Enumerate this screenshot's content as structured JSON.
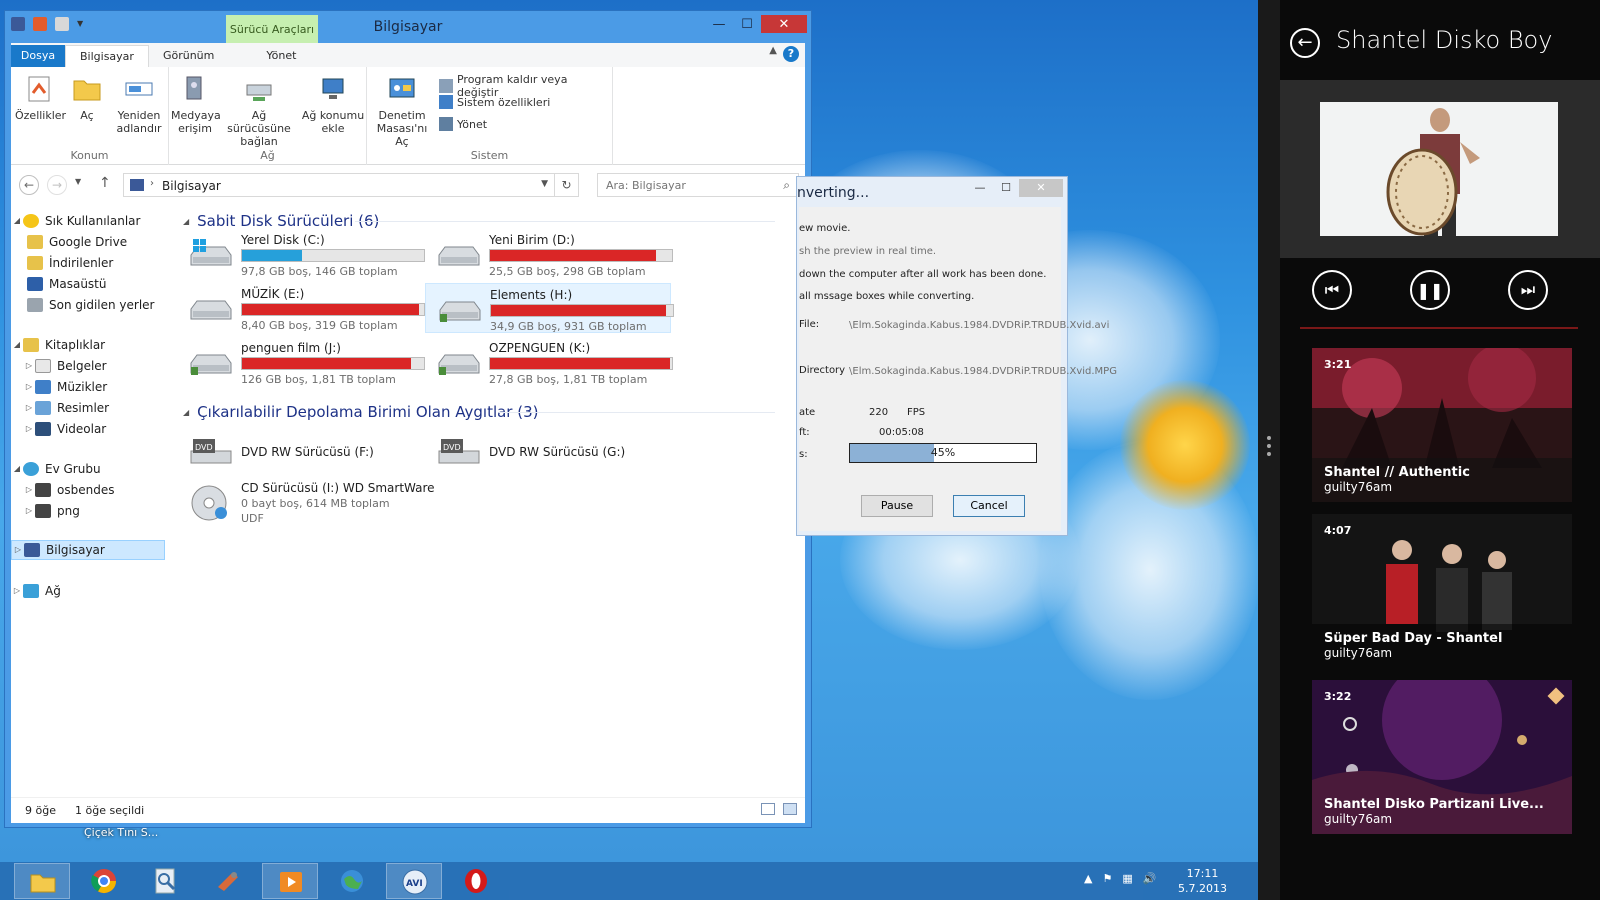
{
  "explorer": {
    "title": "Bilgisayar",
    "context_tab": "Sürücü Araçları",
    "tabs": [
      "Dosya",
      "Bilgisayar",
      "Görünüm",
      "Yönet"
    ],
    "ribbon": {
      "konum": {
        "label": "Konum",
        "buttons": [
          {
            "label": "Özellikler",
            "icon": "properties-icon"
          },
          {
            "label": "Aç",
            "icon": "folder-open-icon"
          },
          {
            "label": "Yeniden adlandır",
            "icon": "rename-icon"
          }
        ]
      },
      "ag": {
        "label": "Ağ",
        "buttons": [
          {
            "label": "Medyaya erişim",
            "icon": "media-access-icon"
          },
          {
            "label": "Ağ sürücüsüne bağlan",
            "icon": "map-drive-icon"
          },
          {
            "label": "Ağ konumu ekle",
            "icon": "add-network-location-icon"
          }
        ]
      },
      "sistem": {
        "label": "Sistem",
        "control_panel": "Denetim Masası'nı Aç",
        "items": [
          "Program kaldır veya değiştir",
          "Sistem özellikleri",
          "Yönet"
        ]
      }
    },
    "address": {
      "path": "Bilgisayar",
      "search_placeholder": "Ara: Bilgisayar"
    },
    "nav": {
      "favorites": {
        "label": "Sık Kullanılanlar",
        "items": [
          "Google Drive",
          "İndirilenler",
          "Masaüstü",
          "Son gidilen yerler"
        ]
      },
      "libraries": {
        "label": "Kitaplıklar",
        "items": [
          "Belgeler",
          "Müzikler",
          "Resimler",
          "Videolar"
        ]
      },
      "homegroup": {
        "label": "Ev Grubu",
        "items": [
          "osbendes",
          "png"
        ]
      },
      "computer": "Bilgisayar",
      "network": "Ağ"
    },
    "groups": {
      "hdd": "Sabit Disk Sürücüleri (6)",
      "removable": "Çıkarılabilir Depolama Birimi Olan Aygıtlar (3)"
    },
    "drives": [
      {
        "name": "Yerel Disk (C:)",
        "free": "97,8 GB boş, 146 GB toplam",
        "used_fraction": 0.33
      },
      {
        "name": "Yeni Birim (D:)",
        "free": "25,5 GB boş, 298 GB toplam",
        "used_fraction": 0.91
      },
      {
        "name": "MÜZİK (E:)",
        "free": "8,40 GB boş, 319 GB toplam",
        "used_fraction": 0.97
      },
      {
        "name": "Elements (H:)",
        "free": "34,9 GB boş, 931 GB toplam",
        "used_fraction": 0.96
      },
      {
        "name": "penguen film (J:)",
        "free": "126 GB boş, 1,81 TB toplam",
        "used_fraction": 0.93
      },
      {
        "name": "OZPENGUEN (K:)",
        "free": "27,8 GB boş, 1,81 TB toplam",
        "used_fraction": 0.99
      }
    ],
    "removable": [
      {
        "name": "DVD RW Sürücüsü (F:)"
      },
      {
        "name": "DVD RW Sürücüsü (G:)"
      },
      {
        "name": "CD Sürücüsü (I:) WD SmartWare",
        "free": "0 bayt boş, 614 MB toplam",
        "fs": "UDF"
      }
    ],
    "status": {
      "count": "9 öğe",
      "selected": "1 öğe seçildi"
    }
  },
  "desktop": {
    "label": "Çiçek Tını S..."
  },
  "dialog": {
    "title": "nverting...",
    "lines": [
      "ew movie.",
      "sh the preview in real time.",
      "down the computer after all work has been done.",
      "all mssage boxes while converting."
    ],
    "file_label": "File:",
    "file_path": "\\Elm.Sokaginda.Kabus.1984.DVDRiP.TRDUB.Xvid.avi",
    "dir_label": "Directory",
    "dir_path": "\\Elm.Sokaginda.Kabus.1984.DVDRiP.TRDUB.Xvid.MPG",
    "rate_label": "ate",
    "rate_value": "220",
    "rate_unit": "FPS",
    "left_label": "ft:",
    "left_value": "00:05:08",
    "progress_label": "s:",
    "progress_text": "45%",
    "progress": 0.45,
    "pause": "Pause",
    "cancel": "Cancel"
  },
  "taskbar": {
    "apps": [
      "file-explorer-icon",
      "chrome-icon",
      "search-icon",
      "tool-icon",
      "media-player-icon",
      "globe-icon",
      "avi-converter-icon",
      "opera-icon"
    ],
    "time": "17:11",
    "date": "5.7.2013"
  },
  "music": {
    "title": "Shantel Disko Boy",
    "videos": [
      {
        "duration": "3:21",
        "title": "Shantel // Authentic",
        "channel": "guilty76am"
      },
      {
        "duration": "4:07",
        "title": "Süper Bad Day - Shantel",
        "channel": "guilty76am"
      },
      {
        "duration": "3:22",
        "title": "Shantel Disko Partizani Live...",
        "channel": "guilty76am"
      }
    ]
  }
}
